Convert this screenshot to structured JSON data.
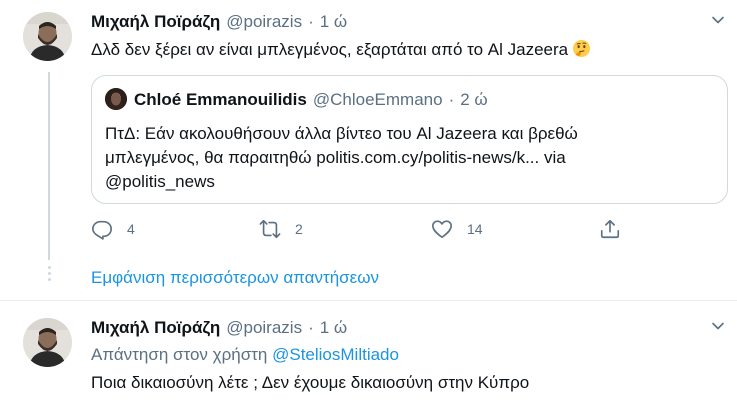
{
  "tweet1": {
    "name": "Μιχαήλ Ποϊράζη",
    "handle": "@poirazis",
    "separator": "·",
    "time": "1 ώ",
    "text": "Δλδ δεν ξέρει αν είναι μπλεγμένος, εξαρτάται από το Al Jazeera",
    "emoji": "thinking-face-emoji",
    "quote": {
      "name": "Chloé Emmanouilidis",
      "handle": "@ChloeEmmano",
      "separator": "·",
      "time": "2 ώ",
      "line1": "ΠτΔ: Εάν ακολουθήσουν άλλα βίντεο του Al Jazeera και βρεθώ",
      "line2": "μπλεγμένος, θα παραιτηθώ politis.com.cy/politis-news/k... via",
      "line3": "@politis_news"
    },
    "actions": {
      "reply_count": "4",
      "retweet_count": "2",
      "like_count": "14"
    }
  },
  "show_more": "Εμφάνιση περισσότερων απαντήσεων",
  "tweet2": {
    "name": "Μιχαήλ Ποϊράζη",
    "handle": "@poirazis",
    "separator": "·",
    "time": "1 ώ",
    "reply_prefix": "Απάντηση στον χρήστη",
    "reply_mention": "@SteliosMiltiado",
    "text": "Ποια δικαιοσύνη λέτε ; Δεν έχουμε δικαιοσύνη στην Κύπρο"
  },
  "colors": {
    "link": "#1b95e0",
    "secondary_text": "#5b7083",
    "border": "#cfd9de"
  }
}
